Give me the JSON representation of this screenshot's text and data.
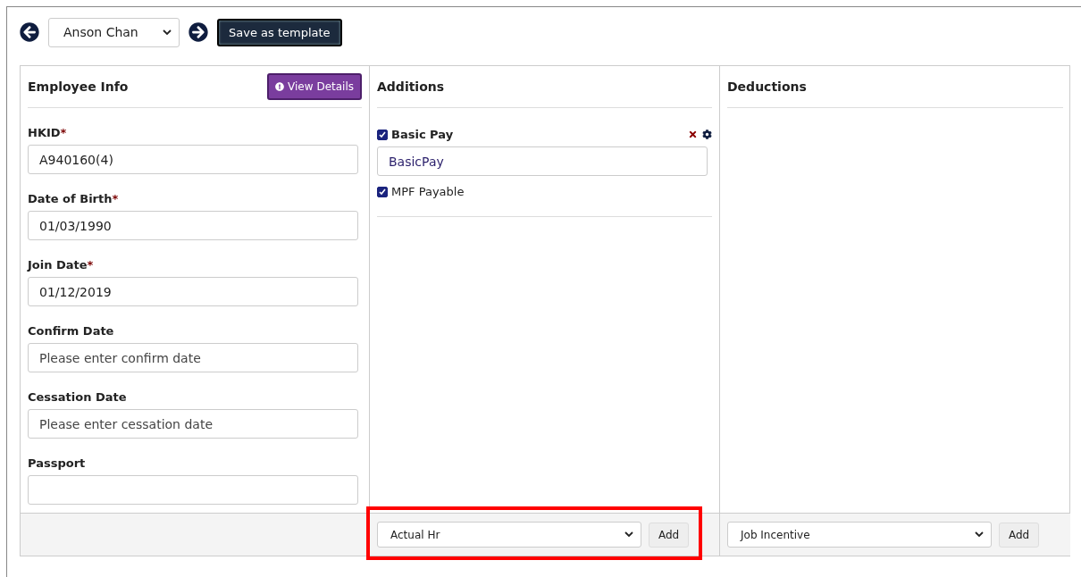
{
  "toolbar": {
    "employee": "Anson Chan",
    "save_button": "Save as template"
  },
  "employee_info": {
    "title": "Employee Info",
    "view_details": "View Details",
    "fields": [
      {
        "label": "HKID",
        "required_mark": "*",
        "value": "A940160(4)"
      },
      {
        "label": "Date of Birth",
        "required_mark": "*",
        "value": "01/03/1990"
      },
      {
        "label": "Join Date",
        "required_mark": "*",
        "value": "01/12/2019"
      },
      {
        "label": "Confirm Date",
        "placeholder": "Please enter confirm date"
      },
      {
        "label": "Cessation Date",
        "placeholder": "Please enter cessation date"
      },
      {
        "label": "Passport"
      }
    ]
  },
  "additions": {
    "title": "Additions",
    "items": [
      {
        "label": "Basic Pay",
        "checked": true,
        "value": "BasicPay",
        "mpf_label": "MPF Payable",
        "mpf_checked": true
      }
    ],
    "select": "Actual Hr",
    "add_button": "Add",
    "highlighted": true
  },
  "deductions": {
    "title": "Deductions",
    "select": "Job Incentive",
    "add_button": "Add"
  }
}
